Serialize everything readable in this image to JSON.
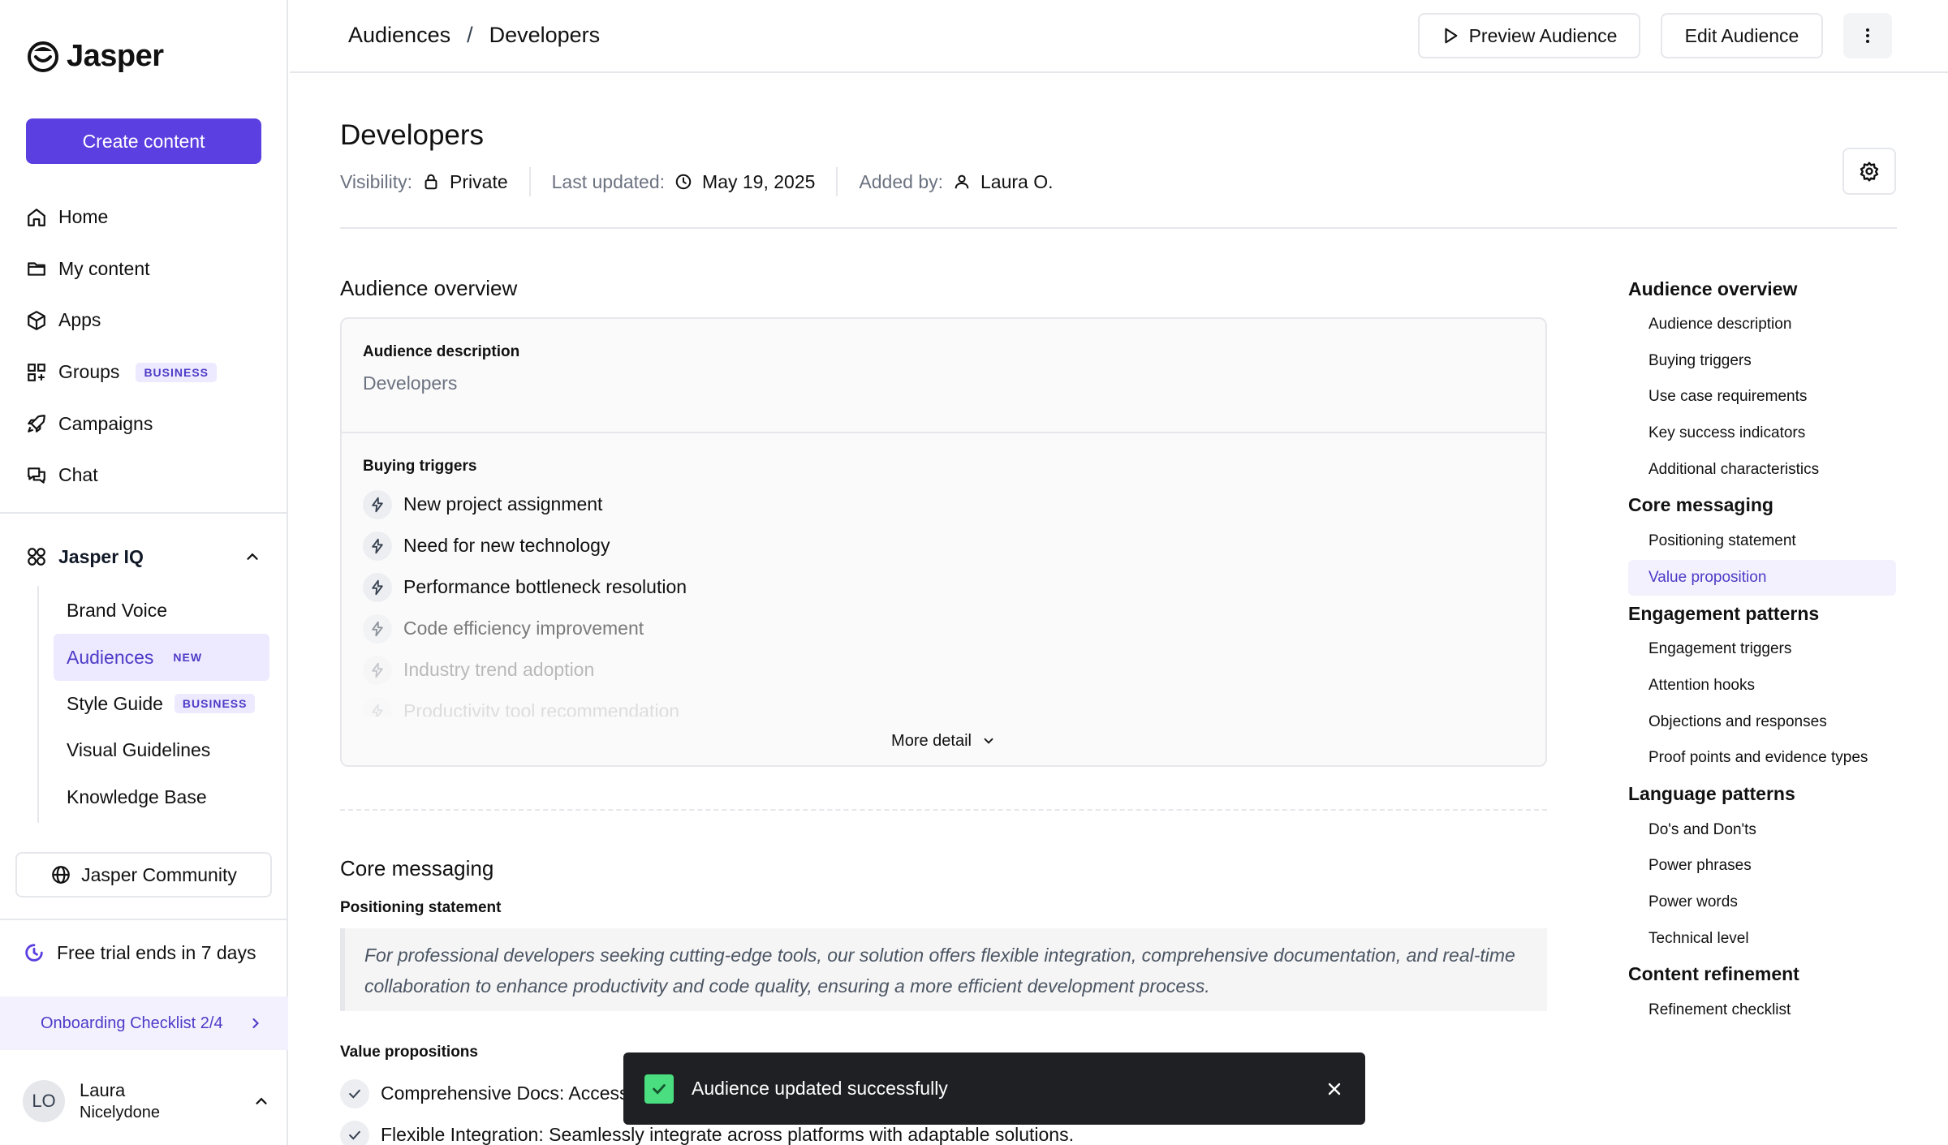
{
  "app": {
    "name": "Jasper"
  },
  "sidebar": {
    "create_label": "Create content",
    "nav": [
      {
        "label": "Home",
        "icon": "home-icon"
      },
      {
        "label": "My content",
        "icon": "folder-icon"
      },
      {
        "label": "Apps",
        "icon": "cube-icon"
      },
      {
        "label": "Groups",
        "icon": "grid-icon",
        "badge": "BUSINESS"
      },
      {
        "label": "Campaigns",
        "icon": "rocket-icon"
      },
      {
        "label": "Chat",
        "icon": "chat-icon"
      }
    ],
    "iq": {
      "label": "Jasper IQ",
      "items": [
        {
          "label": "Brand Voice"
        },
        {
          "label": "Audiences",
          "badge": "NEW",
          "active": true
        },
        {
          "label": "Style Guide",
          "badge": "BUSINESS"
        },
        {
          "label": "Visual Guidelines"
        },
        {
          "label": "Knowledge Base"
        }
      ]
    },
    "community_label": "Jasper Community",
    "trial_label": "Free trial ends in 7 days",
    "onboarding_label": "Onboarding Checklist 2/4",
    "user": {
      "initials": "LO",
      "name": "Laura",
      "org": "Nicelydone"
    }
  },
  "topbar": {
    "breadcrumb": [
      "Audiences",
      "Developers"
    ],
    "separator": "/",
    "preview_label": "Preview Audience",
    "edit_label": "Edit Audience"
  },
  "header": {
    "title": "Developers",
    "visibility_label": "Visibility:",
    "visibility_value": "Private",
    "updated_label": "Last updated:",
    "updated_value": "May 19, 2025",
    "added_label": "Added by:",
    "added_value": "Laura O."
  },
  "overview": {
    "title": "Audience overview",
    "description_label": "Audience description",
    "description_value": "Developers",
    "triggers_label": "Buying triggers",
    "triggers": [
      "New project assignment",
      "Need for new technology",
      "Performance bottleneck resolution",
      "Code efficiency improvement",
      "Industry trend adoption",
      "Productivity tool recommendation"
    ],
    "more_label": "More detail"
  },
  "core": {
    "title": "Core messaging",
    "positioning_label": "Positioning statement",
    "positioning_text": "For professional developers seeking cutting-edge tools, our solution offers flexible integration, comprehensive documentation, and real-time collaboration to enhance productivity and code quality, ensuring a more efficient development process.",
    "vp_label": "Value propositions",
    "vps": [
      "Comprehensive Docs: Access",
      "Flexible Integration: Seamlessly integrate across platforms with adaptable solutions."
    ]
  },
  "toc": [
    {
      "heading": "Audience overview",
      "items": [
        "Audience description",
        "Buying triggers",
        "Use case requirements",
        "Key success indicators",
        "Additional characteristics"
      ]
    },
    {
      "heading": "Core messaging",
      "items": [
        "Positioning statement",
        "Value proposition"
      ]
    },
    {
      "heading": "Engagement patterns",
      "items": [
        "Engagement triggers",
        "Attention hooks",
        "Objections and responses",
        "Proof points and evidence types"
      ]
    },
    {
      "heading": "Language patterns",
      "items": [
        "Do's and Don'ts",
        "Power phrases",
        "Power words",
        "Technical level"
      ]
    },
    {
      "heading": "Content refinement",
      "items": [
        "Refinement checklist"
      ]
    }
  ],
  "toc_active": "Value proposition",
  "toast": {
    "message": "Audience updated successfully"
  },
  "colors": {
    "accent": "#5b3fe0",
    "accent_soft": "#ede9fe",
    "toast_bg": "#1f2023",
    "success": "#4ade80"
  }
}
